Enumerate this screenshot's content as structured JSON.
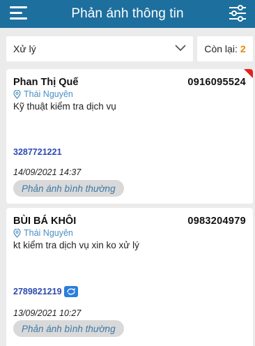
{
  "header": {
    "title": "Phản ánh thông tin",
    "menu_icon": "hamburger-menu-icon",
    "filter_icon": "sliders-filter-icon",
    "color": "#1d6f9e"
  },
  "toolbar": {
    "status_select": "Xử lý",
    "remaining_label": "Còn lại:",
    "remaining_count": "2"
  },
  "cards": [
    {
      "name": "Phan Thị Quế",
      "phone": "0916095524",
      "location": "Thái Nguyên",
      "description": "Kỹ thuật kiểm tra dịch vụ",
      "code": "3287721221",
      "datetime": "14/09/2021 14:37",
      "badge": "Phản ánh bình thường",
      "flagged": true
    },
    {
      "name": "BÙI BÁ KHÔI",
      "phone": "0983204979",
      "location": "Thái Nguyên",
      "description": "kt kiểm tra dịch vụ xin ko xử lý",
      "code": "2789821219",
      "datetime": "13/09/2021 10:27",
      "badge": "Phản ánh bình thường",
      "flagged": false
    }
  ]
}
